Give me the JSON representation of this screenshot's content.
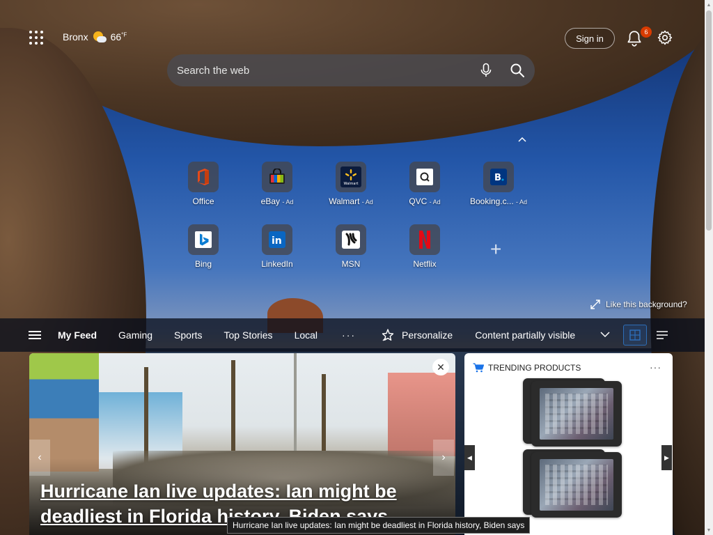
{
  "topbar": {
    "location": "Bronx",
    "temperature": "66",
    "temp_unit": "°F",
    "weather_icon": "partly-sunny-icon",
    "sign_in_label": "Sign in",
    "notification_count": "6"
  },
  "search": {
    "placeholder": "Search the web"
  },
  "quick_links": [
    {
      "label": "Office",
      "ad": "",
      "icon": "office-icon",
      "color": "#d83b01"
    },
    {
      "label": "eBay",
      "ad": "- Ad",
      "icon": "ebay-icon",
      "color": "#e53238"
    },
    {
      "label": "Walmart",
      "ad": "- Ad",
      "icon": "walmart-icon",
      "color": "#0071ce"
    },
    {
      "label": "QVC",
      "ad": "- Ad",
      "icon": "qvc-icon",
      "color": "#ffffff"
    },
    {
      "label": "Booking.c...",
      "ad": "- Ad",
      "icon": "booking-icon",
      "color": "#003580"
    },
    {
      "label": "Bing",
      "ad": "",
      "icon": "bing-icon",
      "color": "#0078d4"
    },
    {
      "label": "LinkedIn",
      "ad": "",
      "icon": "linkedin-icon",
      "color": "#0a66c2"
    },
    {
      "label": "MSN",
      "ad": "",
      "icon": "msn-icon",
      "color": "#ffffff"
    },
    {
      "label": "Netflix",
      "ad": "",
      "icon": "netflix-icon",
      "color": "#e50914"
    }
  ],
  "like_background": "Like this background?",
  "feed_nav": {
    "tabs": [
      "My Feed",
      "Gaming",
      "Sports",
      "Top Stories",
      "Local"
    ],
    "more": "···",
    "personalize": "Personalize",
    "content_visibility": "Content partially visible"
  },
  "hero": {
    "title": "Hurricane Ian live updates: Ian might be deadliest in Florida history, Biden says"
  },
  "trending": {
    "title": "TRENDING PRODUCTS",
    "more": "···"
  },
  "tooltip": "Hurricane Ian live updates: Ian might be deadliest in Florida history, Biden says"
}
